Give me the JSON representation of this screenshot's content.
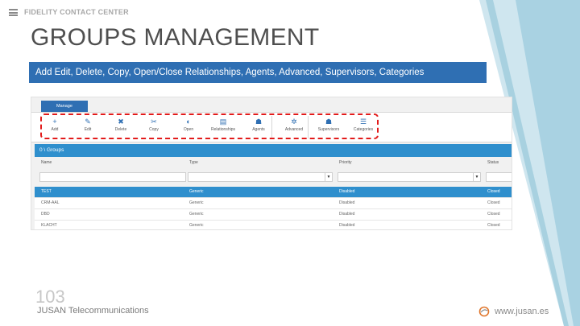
{
  "header": {
    "brand": "FIDELITY CONTACT CENTER",
    "title": "GROUPS MANAGEMENT",
    "banner": "Add Edit, Delete, Copy, Open/Close Relationships, Agents, Advanced, Supervisors, Categories"
  },
  "app": {
    "manage_tab": "Manage",
    "toolbar": [
      {
        "label": "Add",
        "icon": "add-icon",
        "glyph": "+"
      },
      {
        "label": "Edit",
        "icon": "pencil-icon",
        "glyph": "✎"
      },
      {
        "label": "Delete",
        "icon": "delete-icon",
        "glyph": "✖"
      },
      {
        "label": "Copy",
        "icon": "copy-icon",
        "glyph": "✂"
      },
      {
        "label": "Open",
        "icon": "toggle-icon",
        "glyph": "◐"
      },
      {
        "label": "Relationships",
        "icon": "relationships-icon",
        "glyph": "▤"
      },
      {
        "label": "Agents",
        "icon": "agents-icon",
        "glyph": "☗"
      },
      {
        "label": "Advanced",
        "icon": "advanced-icon",
        "glyph": "✲"
      },
      {
        "label": "Supervisors",
        "icon": "supervisor-icon",
        "glyph": "☗"
      },
      {
        "label": "Categories",
        "icon": "categories-icon",
        "glyph": "☰"
      }
    ],
    "groups_bar": "0 \\ Groups",
    "columns": [
      "Name",
      "Type",
      "Priority",
      "Status"
    ],
    "rows": [
      {
        "name": "TEST",
        "type": "Generic",
        "priority": "Disabled",
        "status": "Closed",
        "selected": true
      },
      {
        "name": "CRM-AAL",
        "type": "Generic",
        "priority": "Disabled",
        "status": "Closed",
        "selected": false
      },
      {
        "name": "DBD",
        "type": "Generic",
        "priority": "Disabled",
        "status": "Closed",
        "selected": false
      },
      {
        "name": "KLACHT",
        "type": "Generic",
        "priority": "Disabled",
        "status": "Closed",
        "selected": false
      }
    ]
  },
  "footer": {
    "page_number": "103",
    "company": "JUSAN Telecommunications",
    "website": "www.jusan.es"
  },
  "colors": {
    "accent": "#2f6fb3",
    "highlight": "#e21b1b",
    "deco_light": "#cfe6ef",
    "deco_dark": "#a9d2e2"
  }
}
